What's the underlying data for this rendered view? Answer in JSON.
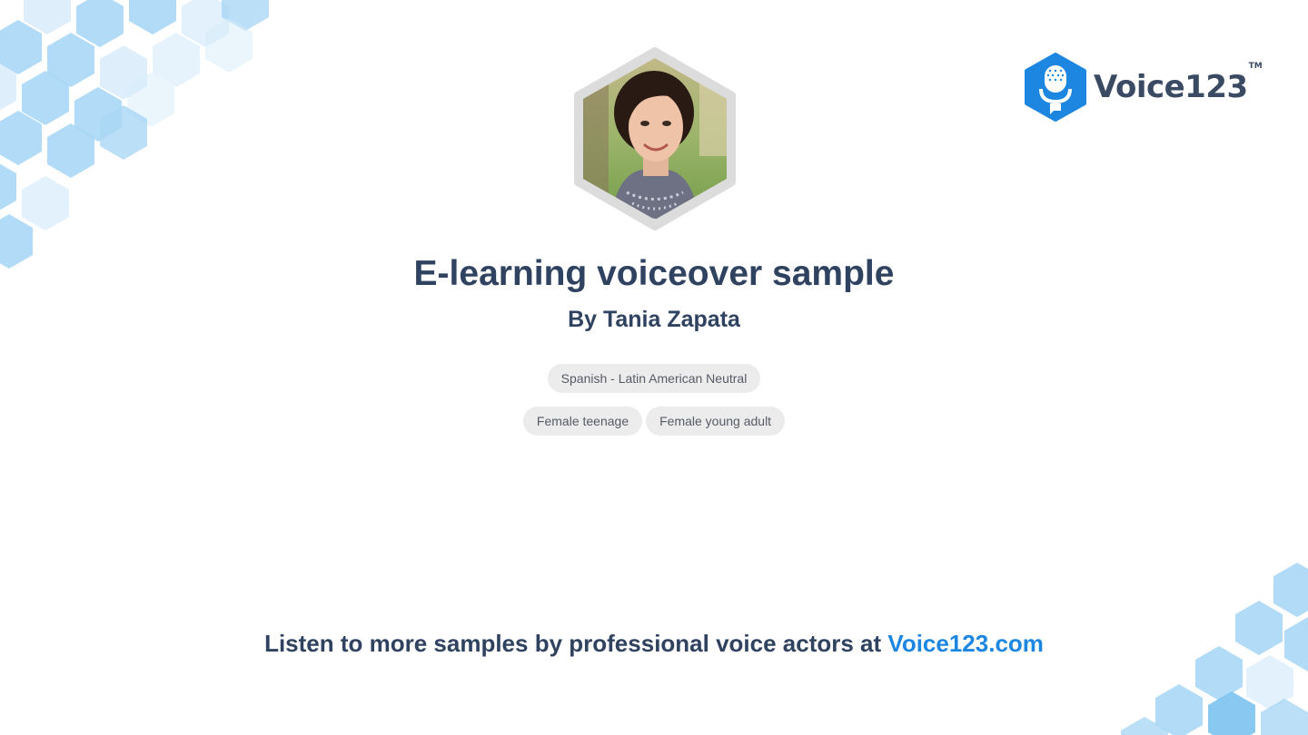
{
  "brand": {
    "name": "Voice123",
    "tm": "TM",
    "logo_color": "#1c86e0",
    "text_color": "#3a4a63"
  },
  "profile": {
    "avatar": "portrait-photo",
    "title": "E-learning voiceover sample",
    "byline": "By Tania Zapata"
  },
  "tags": {
    "row1": [
      "Spanish - Latin American Neutral"
    ],
    "row2": [
      "Female teenage",
      "Female young adult"
    ]
  },
  "footer": {
    "text": "Listen to more samples by professional voice actors at ",
    "link": "Voice123.com"
  },
  "colors": {
    "heading": "#2f4260",
    "accent": "#1c86e0",
    "tag_bg": "#ececec",
    "hex_light": "#d6ebfa",
    "hex_mid": "#a9d7f5",
    "hex_dark": "#7cc3f0"
  }
}
